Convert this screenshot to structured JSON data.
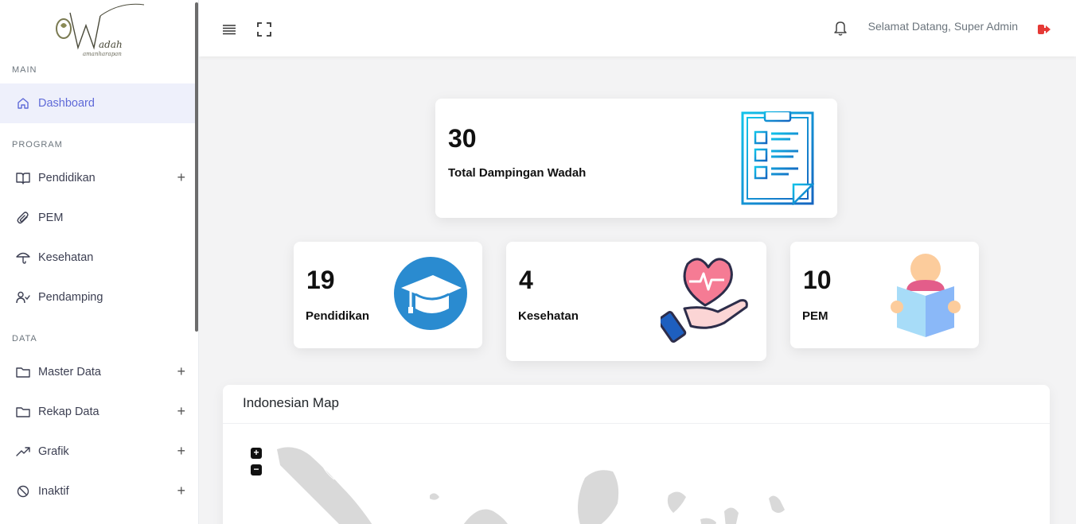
{
  "sidebar": {
    "sections": {
      "main": "MAIN",
      "program": "PROGRAM",
      "data": "DATA"
    },
    "items": {
      "dashboard": "Dashboard",
      "pendidikan": "Pendidikan",
      "pem": "PEM",
      "kesehatan": "Kesehatan",
      "pendamping": "Pendamping",
      "master_data": "Master Data",
      "rekap_data": "Rekap Data",
      "grafik": "Grafik",
      "inaktif": "Inaktif"
    },
    "expand_symbol": "+"
  },
  "header": {
    "welcome": "Selamat Datang, Super Admin"
  },
  "stats": {
    "total": {
      "value": "30",
      "label": "Total Dampingan Wadah"
    },
    "pendidikan": {
      "value": "19",
      "label": "Pendidikan"
    },
    "kesehatan": {
      "value": "4",
      "label": "Kesehatan"
    },
    "pem": {
      "value": "10",
      "label": "PEM"
    }
  },
  "map": {
    "title": "Indonesian Map",
    "zoom_in": "+",
    "zoom_out": "−"
  },
  "colors": {
    "accent": "#5f6ad8",
    "logout": "#e53935",
    "active_bg": "#eef0fb"
  }
}
